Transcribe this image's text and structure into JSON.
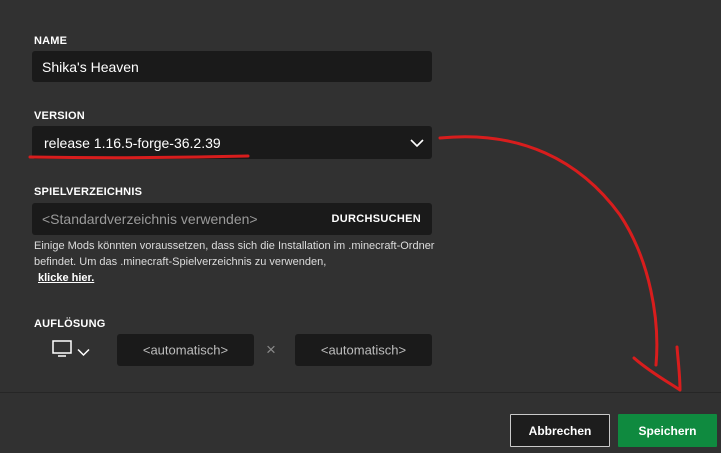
{
  "name": {
    "label": "NAME",
    "value": "Shika's Heaven"
  },
  "version": {
    "label": "VERSION",
    "value": "release 1.16.5-forge-36.2.39"
  },
  "game_dir": {
    "label": "SPIELVERZEICHNIS",
    "placeholder": "<Standardverzeichnis verwenden>",
    "browse_label": "DURCHSUCHEN",
    "help_text": "Einige Mods könnten voraussetzen, dass sich die Installation im .minecraft-Ordner befindet. Um das .minecraft-Spielverzeichnis zu verwenden,",
    "help_link": "klicke hier."
  },
  "resolution": {
    "label": "AUFLÖSUNG",
    "width_placeholder": "<automatisch>",
    "height_placeholder": "<automatisch>",
    "separator": "×"
  },
  "footer": {
    "cancel_label": "Abbrechen",
    "save_label": "Speichern"
  },
  "colors": {
    "accent_green": "#0f8a3f",
    "annotation_red": "#d81d1d",
    "background": "#313131",
    "field": "#1a1a1a"
  }
}
